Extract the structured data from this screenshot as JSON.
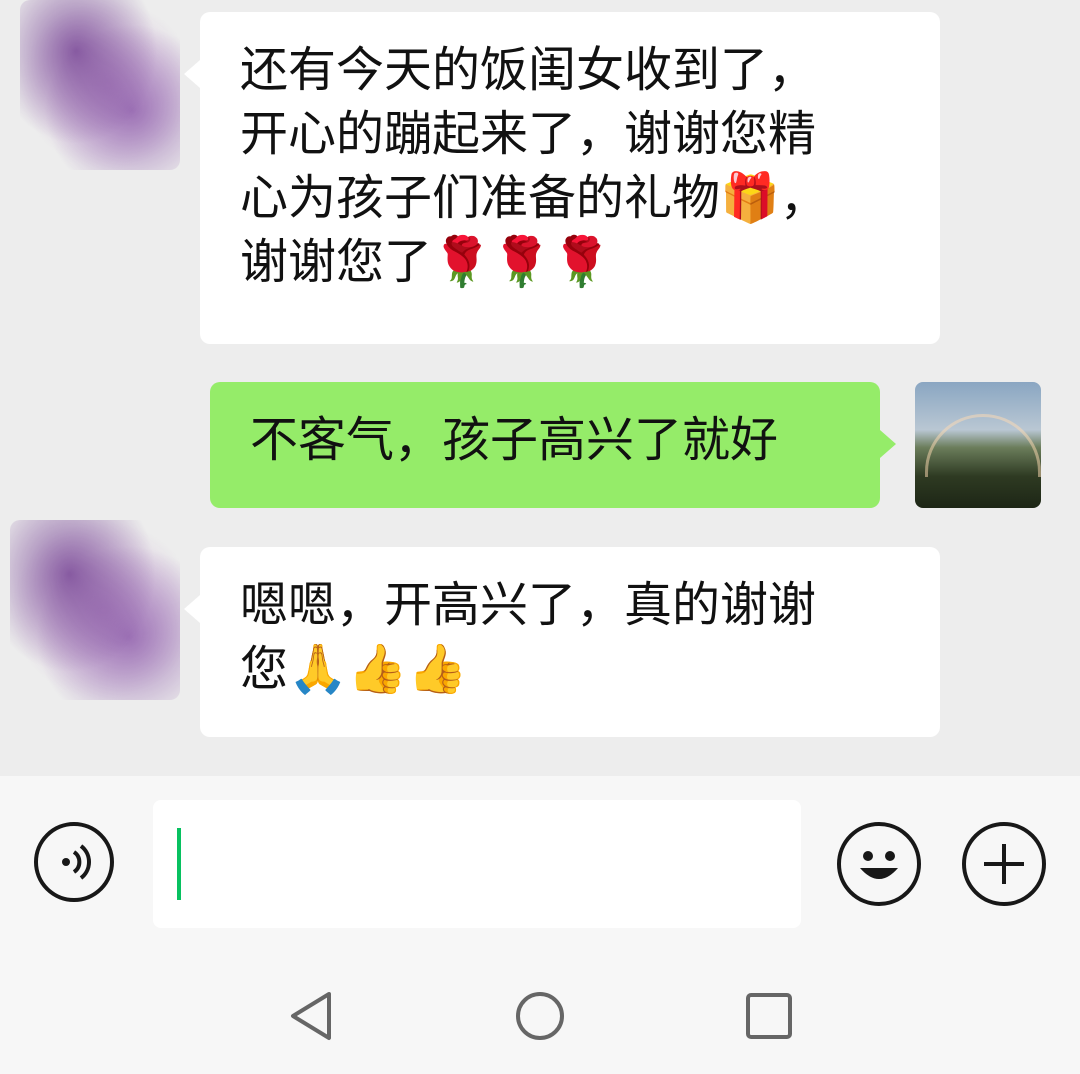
{
  "messages": [
    {
      "sender": "other",
      "text": "还有今天的饭闺女收到了，\n开心的蹦起来了，谢谢您精\n心为孩子们准备的礼物🎁，\n谢谢您了🌹🌹🌹"
    },
    {
      "sender": "me",
      "text": "不客气，孩子高兴了就好"
    },
    {
      "sender": "other",
      "text": "嗯嗯，开高兴了，真的谢谢\n您🙏👍👍"
    }
  ],
  "input": {
    "value": ""
  },
  "icons": {
    "voice": "voice-icon",
    "emoji": "smiley-icon",
    "plus": "plus-icon",
    "back": "back-triangle-icon",
    "home": "home-circle-icon",
    "recent": "recent-square-icon"
  },
  "colors": {
    "chat_bg": "#ededed",
    "bubble_other": "#ffffff",
    "bubble_me": "#95ec69",
    "caret": "#07c160",
    "input_bar": "#f7f7f7"
  }
}
